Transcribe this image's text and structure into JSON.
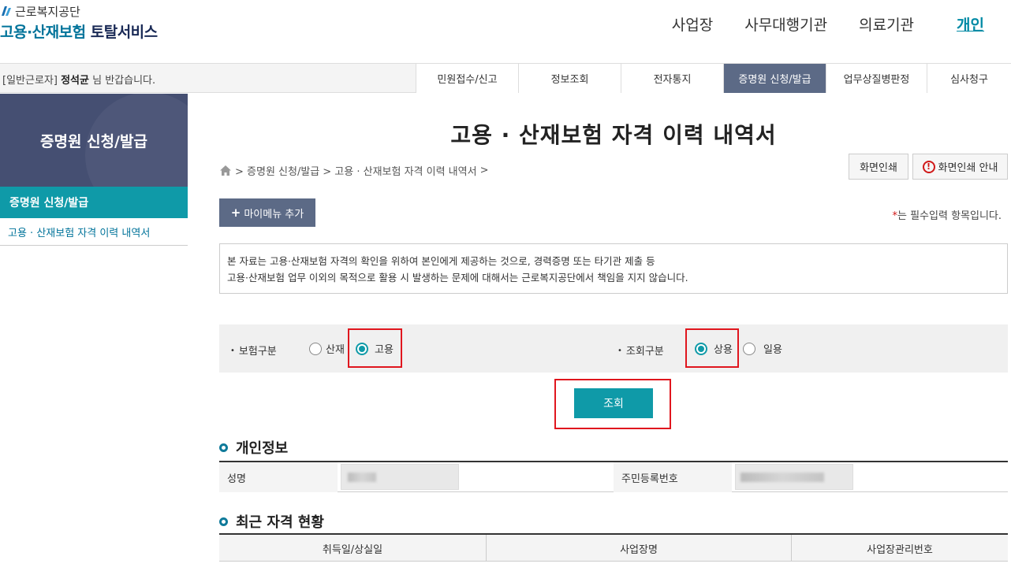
{
  "logo": {
    "org": "근로복지공단",
    "service_part1": "고용·산재보험",
    "service_part2": "토탈서비스"
  },
  "top_nav": [
    "사업장",
    "사무대행기관",
    "의료기관",
    "개인"
  ],
  "welcome": {
    "prefix": "[일반근로자]",
    "name": "정석균",
    "suffix": "님 반갑습니다."
  },
  "gnb": [
    "민원접수/신고",
    "정보조회",
    "전자통지",
    "증명원 신청/발급",
    "업무상질병판정",
    "심사청구"
  ],
  "lnb": {
    "title": "증명원 신청/발급",
    "selected": "증명원 신청/발급",
    "sub": "고용 · 산재보험 자격 이력 내역서"
  },
  "page": {
    "title": "고용 · 산재보험 자격 이력 내역서",
    "breadcrumb": [
      "> 증명원 신청/발급",
      "> 고용 · 산재보험 자격 이력 내역서",
      ">"
    ],
    "print_label": "화면인쇄",
    "print_guide_label": "화면인쇄 안내",
    "mymenu_label": "마이메뉴 추가",
    "required_note": "는 필수입력 항목입니다.",
    "required_star": "*",
    "notice_line1": "본 자료는 고용·산재보험 자격의 확인을 위하여 본인에게 제공하는 것으로, 경력증명 또는 타기관 제출 등",
    "notice_line2": "고용·산재보험 업무 이외의 목적으로 활용 시 발생하는 문제에 대해서는 근로복지공단에서 책임을 지지 않습니다."
  },
  "search": {
    "insurance_label": "보험구분",
    "insurance_options": [
      "산재",
      "고용"
    ],
    "insurance_selected": "고용",
    "inquiry_label": "조회구분",
    "inquiry_options": [
      "상용",
      "일용"
    ],
    "inquiry_selected": "상용",
    "button_label": "조회"
  },
  "personal": {
    "section_title": "개인정보",
    "name_label": "성명",
    "rrn_label": "주민등록번호"
  },
  "recent": {
    "section_title": "최근 자격 현황",
    "columns": [
      "취득일/상실일",
      "사업장명",
      "사업장관리번호"
    ]
  },
  "colors": {
    "accent": "#0f9aa8",
    "nav_active": "#5c6a86",
    "highlight": "#e0161e"
  }
}
